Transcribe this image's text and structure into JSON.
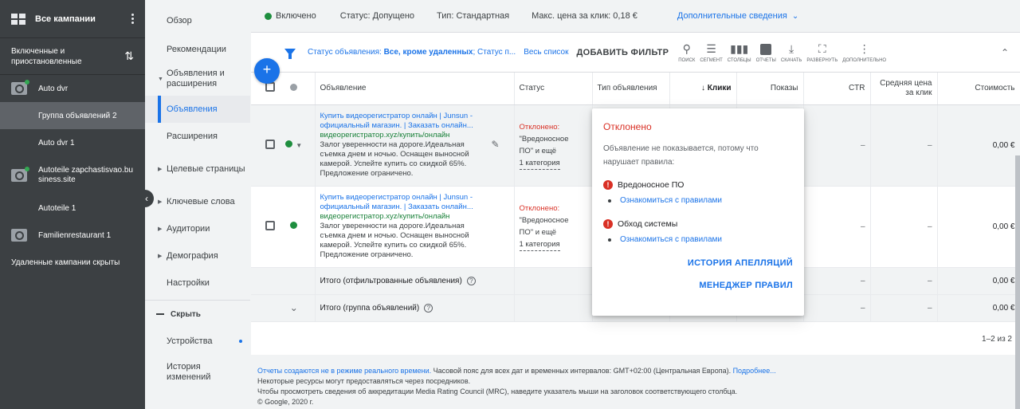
{
  "sidebar": {
    "title": "Все кампании",
    "filter_label": "Включенные и приостановленные",
    "items": [
      {
        "label": "Auto dvr"
      },
      {
        "label": "Группа объявлений 2"
      },
      {
        "label": "Auto dvr 1"
      },
      {
        "label": "Autoteile zapchastisvao.business.site"
      },
      {
        "label": "Autoteile 1"
      },
      {
        "label": "Familienrestaurant 1"
      }
    ],
    "footer": "Удаленные кампании скрыты"
  },
  "page_menu": {
    "items": [
      "Обзор",
      "Рекомендации",
      "Объявления и расширения",
      "Объявления",
      "Расширения",
      "Целевые страницы",
      "Ключевые слова",
      "Аудитории",
      "Демография",
      "Настройки"
    ],
    "hide_label": "Скрыть",
    "extra": [
      "Устройства",
      "История изменений"
    ]
  },
  "status_bar": {
    "state": "Включено",
    "status": "Статус: Допущено",
    "type": "Тип: Стандартная",
    "max_cpc": "Макс. цена за клик: 0,18 €",
    "more": "Дополнительные сведения"
  },
  "toolbar": {
    "filter_prefix": "Статус объявления: ",
    "filter_value": "Все, кроме удаленных",
    "filter_suffix": "; Статус п...",
    "full_list": "Весь список",
    "add_filter": "ДОБАВИТЬ ФИЛЬТР",
    "tools": [
      "поиск",
      "сегмент",
      "столбцы",
      "отчеты",
      "скачать",
      "развернуть",
      "дополнительно"
    ]
  },
  "table": {
    "headers": {
      "ad": "Объявление",
      "status": "Статус",
      "type": "Тип объявления",
      "clicks": "Клики",
      "impr": "Показы",
      "ctr": "CTR",
      "avg_cpc": "Средняя цена за клик",
      "cost": "Стоимость"
    },
    "rows": [
      {
        "title": "Купить видеорегистратор онлайн | Junsun - официальный магазин. | Заказать онлайн...",
        "url": "видеорегистратор.xyz/купить/онлайн",
        "desc": "Залог уверенности на дороге.Идеальная съемка днем и ночью. Оснащен выносной камерой. Успейте купить со скидкой 65%. Предложение ограничено.",
        "status_red": "Отклонено:",
        "status_1": "\"Вредоносное",
        "status_2": "ПО\" и ещё",
        "status_3": "1 категория",
        "ctr": "–",
        "cpc": "–",
        "cost": "0,00 €"
      },
      {
        "title": "Купить видеорегистратор онлайн | Junsun - официальный магазин. | Заказать онлайн...",
        "url": "видеорегистратор.xyz/купить/онлайн",
        "desc": "Залог уверенности на дороге.Идеальная съемка днем и ночью. Оснащен выносной камерой. Успейте купить со скидкой 65%. Предложение ограничено.",
        "status_red": "Отклонено:",
        "status_1": "\"Вредоносное",
        "status_2": "ПО\" и ещё",
        "status_3": "1 категория",
        "ctr": "–",
        "cpc": "–",
        "cost": "0,00 €"
      }
    ],
    "total_filtered": {
      "label": "Итого (отфильтрованные объявления)",
      "ctr": "–",
      "cpc": "–",
      "cost": "0,00 €"
    },
    "total_group": {
      "label": "Итого (группа объявлений)",
      "ctr": "–",
      "cpc": "–",
      "cost": "0,00 €"
    },
    "pager": "1–2 из 2"
  },
  "popover": {
    "title": "Отклонено",
    "desc": "Объявление не показывается, потому что нарушает правила:",
    "issues": [
      {
        "label": "Вредоносное ПО",
        "link": "Ознакомиться с правилами"
      },
      {
        "label": "Обход системы",
        "link": "Ознакомиться с правилами"
      }
    ],
    "btn_appeals": "ИСТОРИЯ АПЕЛЛЯЦИЙ",
    "btn_policy": "МЕНЕДЖЕР ПРАВИЛ"
  },
  "footer": {
    "line1_link": "Отчеты создаются не в режиме реального времени.",
    "line1_text": " Часовой пояс для всех дат и временных интервалов: GMT+02:00 (Центральная Европа).",
    "line1_more": " Подробнее...",
    "line2": "Некоторые ресурсы могут предоставляться через посредников.",
    "line3": "Чтобы просмотреть сведения об аккредитации Media Rating Council (MRC), наведите указатель мыши на заголовок соответствующего столбца.",
    "line4": "© Google, 2020 г."
  }
}
